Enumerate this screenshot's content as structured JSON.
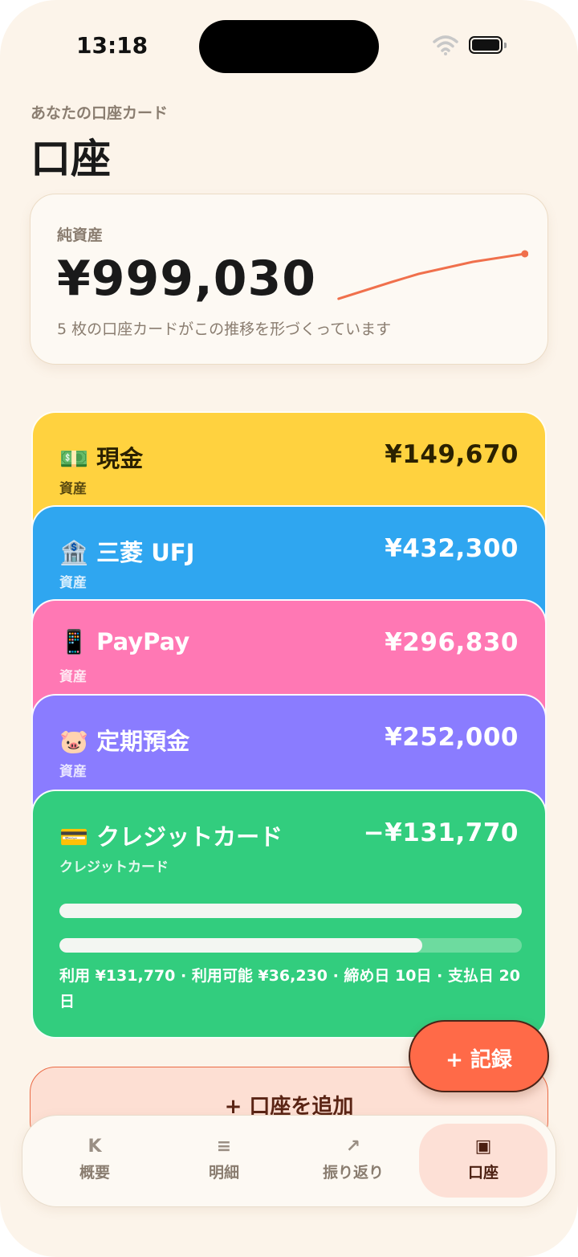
{
  "status_bar": {
    "time": "13:18"
  },
  "header": {
    "subtitle": "あなたの口座カード",
    "title": "口座"
  },
  "net_worth": {
    "label": "純資産",
    "amount": "¥999,030",
    "caption": "5 枚の口座カードがこの推移を形づくっています",
    "trend_color": "#f0704c"
  },
  "accounts": [
    {
      "emoji": "💵",
      "name": "現金",
      "amount": "¥149,670",
      "kind": "資産",
      "color": "#ffd23f"
    },
    {
      "emoji": "🏦",
      "name": "三菱 UFJ",
      "amount": "¥432,300",
      "kind": "資産",
      "color": "#2fa6f0"
    },
    {
      "emoji": "📱",
      "name": "PayPay",
      "amount": "¥296,830",
      "kind": "資産",
      "color": "#ff78b4"
    },
    {
      "emoji": "🐷",
      "name": "定期預金",
      "amount": "¥252,000",
      "kind": "資産",
      "color": "#8a7cff"
    },
    {
      "emoji": "💳",
      "name": "クレジットカード",
      "amount": "−¥131,770",
      "kind": "クレジットカード",
      "color": "#32cd7e",
      "usage_fraction": 0.784,
      "info": "利用 ¥131,770 · 利用可能 ¥36,230 · 締め日 10日 · 支払日 20日"
    }
  ],
  "add_account": {
    "label": "+ 口座を追加"
  },
  "fab": {
    "label": "+ 記録"
  },
  "tabbar": {
    "items": [
      {
        "icon": "K",
        "label": "概要",
        "active": false
      },
      {
        "icon": "≡",
        "label": "明細",
        "active": false
      },
      {
        "icon": "↗",
        "label": "振り返り",
        "active": false
      },
      {
        "icon": "▣",
        "label": "口座",
        "active": true
      }
    ]
  },
  "colors": {
    "background": "#fcf4ea",
    "accent": "#ff6a48"
  }
}
